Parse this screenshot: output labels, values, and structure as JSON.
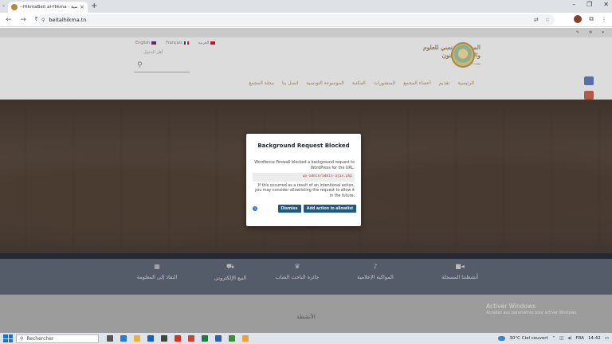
{
  "browser": {
    "tab_title": "--HikmaBeit al-Hikma - الرئيسية",
    "url": "beitalhikma.tn",
    "new_tab_symbol": "+"
  },
  "site": {
    "languages": [
      "English",
      "Français",
      "العربية"
    ],
    "login_label": "أهل الدخول",
    "logo_line1": "المجمع التونسي للعلوم",
    "logo_line2": "والآداب والفنون",
    "logo_line3": "بيت الحكمة",
    "nav": [
      "الرئيسية",
      "تقديم",
      "أعضاء المجمع",
      "المنشورات",
      "المكتبة",
      "الموسوعة التونسية",
      "اتصل بنا",
      "مجلة المجمع"
    ]
  },
  "features": [
    {
      "label": "أنشطتنا المسجلة",
      "icon": "video-icon"
    },
    {
      "label": "المواكبة الإعلامية",
      "icon": "microphone-icon"
    },
    {
      "label": "جائزة الباحث الشاب",
      "icon": "trophy-icon"
    },
    {
      "label": "البيع الإلكتروني",
      "icon": "cart-icon"
    },
    {
      "label": "النفاذ إلى المعلومة",
      "icon": "calendar-icon"
    }
  ],
  "section_title": "الأنشطة",
  "watermark": {
    "line1": "Activer Windows",
    "line2": "Accédez aux paramètres pour activer Windows."
  },
  "modal": {
    "title": "Background Request Blocked",
    "text1": "Wordfence Firewall blocked a background request to WordPress for the URL:",
    "url": "wp-admin/admin-ajax.php",
    "text2": "If this occurred as a result of an intentional action, you may consider allowlisting the request to allow it in the future.",
    "dismiss_label": "Dismiss",
    "allowlist_label": "Add action to allowlist"
  },
  "taskbar": {
    "search_placeholder": "Rechercher",
    "weather": "30°C  Ciel couvert",
    "language": "FRA",
    "time": "14:42"
  }
}
